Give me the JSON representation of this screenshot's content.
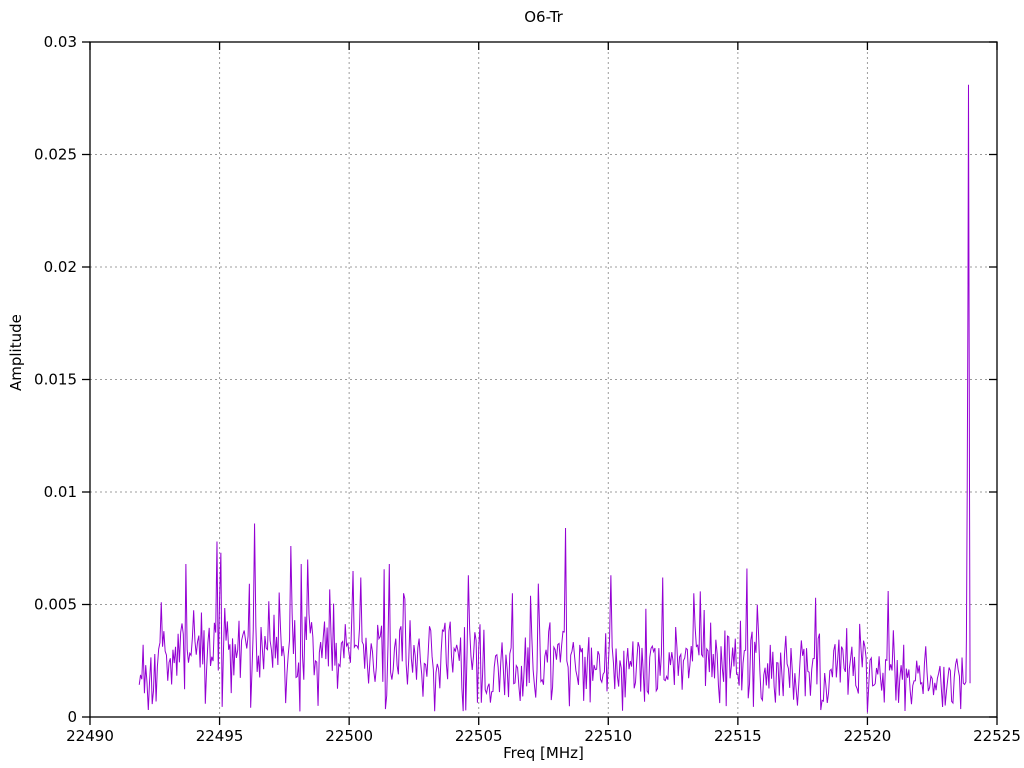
{
  "window": {
    "background": "#ffffff",
    "frame_color": "#000000",
    "grid_color": "#9c9c9c"
  },
  "chart_data": {
    "type": "line",
    "title": "O6-Tr",
    "xlabel": "Freq [MHz]",
    "ylabel": "Amplitude",
    "xlim": [
      22490,
      22525
    ],
    "ylim": [
      0,
      0.03
    ],
    "x_ticks": [
      22490,
      22495,
      22500,
      22505,
      22510,
      22515,
      22520,
      22525
    ],
    "x_tick_labels": [
      "22490",
      "22495",
      "22500",
      "22505",
      "22510",
      "22515",
      "22520",
      "22525"
    ],
    "y_ticks": [
      0,
      0.005,
      0.01,
      0.015,
      0.02,
      0.025,
      0.03
    ],
    "y_tick_labels": [
      "0",
      "0.005",
      "0.01",
      "0.015",
      "0.02",
      "0.025",
      "0.03"
    ],
    "grid": true,
    "grid_style": "dotted",
    "legend": "none",
    "line_color": "#9400d3",
    "line_width": 1,
    "data_x_range": [
      22491.9,
      22523.8
    ],
    "point_spacing_mhz": 0.05,
    "noise_model": {
      "seed": 1337,
      "floor": 0.0002,
      "ceiling": 0.0068,
      "envelope": [
        [
          22491.9,
          0.0019,
          0.0011
        ],
        [
          22493.5,
          0.003,
          0.0014
        ],
        [
          22496.0,
          0.0032,
          0.0015
        ],
        [
          22499.0,
          0.003,
          0.0015
        ],
        [
          22503.0,
          0.0027,
          0.0014
        ],
        [
          22507.0,
          0.0026,
          0.0013
        ],
        [
          22511.0,
          0.0024,
          0.0013
        ],
        [
          22515.0,
          0.0025,
          0.0013
        ],
        [
          22519.0,
          0.0021,
          0.0012
        ],
        [
          22523.8,
          0.0016,
          0.0009
        ]
      ]
    },
    "notable_peaks": [
      [
        22494.9,
        0.0078
      ],
      [
        22495.05,
        0.0073
      ],
      [
        22496.35,
        0.0086
      ],
      [
        22497.75,
        0.0076
      ],
      [
        22498.4,
        0.007
      ],
      [
        22500.45,
        0.0062
      ],
      [
        22502.1,
        0.0055
      ],
      [
        22504.6,
        0.0063
      ],
      [
        22506.3,
        0.0055
      ],
      [
        22508.35,
        0.0084
      ],
      [
        22510.1,
        0.0063
      ],
      [
        22512.1,
        0.0062
      ],
      [
        22513.3,
        0.0055
      ],
      [
        22515.35,
        0.0066
      ],
      [
        22518.0,
        0.0053
      ],
      [
        22520.8,
        0.0056
      ]
    ],
    "main_spike": {
      "freq": 22523.9,
      "peak": 0.0281,
      "shoulder": 0.019,
      "base": 0.0099,
      "tail": 0.0015
    }
  }
}
